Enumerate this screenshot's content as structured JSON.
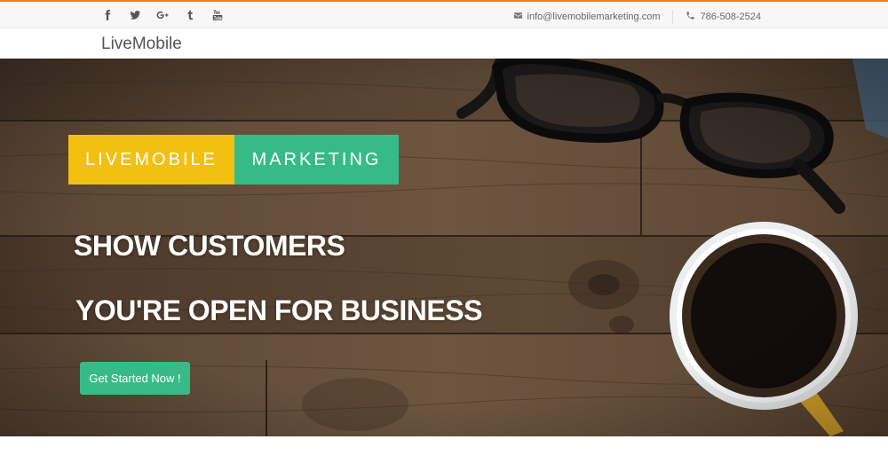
{
  "topbar": {
    "accent_color": "#f07c24",
    "social_icons": [
      "facebook-icon",
      "twitter-icon",
      "google-plus-icon",
      "tumblr-icon",
      "youtube-icon"
    ],
    "email": "info@livemobilemarketing.com",
    "phone": "786-508-2524"
  },
  "navbar": {
    "brand": "LiveMobile"
  },
  "hero": {
    "tag_left": "LIVEMOBILE",
    "tag_right": "MARKETING",
    "tag_left_color": "#f2c010",
    "tag_right_color": "#36bb88",
    "headline_line1": "SHOW CUSTOMERS",
    "headline_line2": "YOU'RE OPEN FOR BUSINESS",
    "cta_label": "Get Started Now !"
  }
}
